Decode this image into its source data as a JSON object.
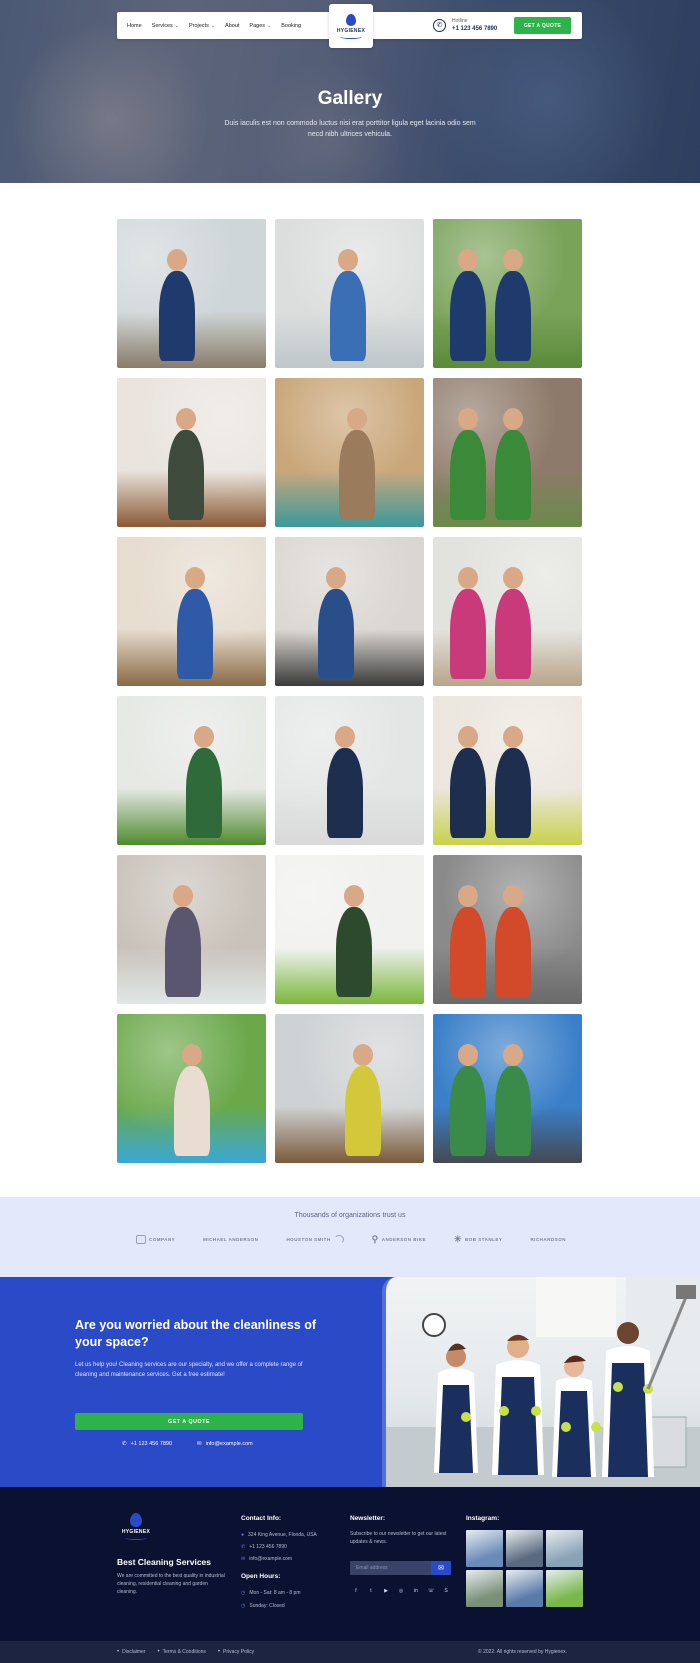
{
  "nav": {
    "links": [
      {
        "label": "Home",
        "dropdown": false
      },
      {
        "label": "Services",
        "dropdown": true
      },
      {
        "label": "Projects",
        "dropdown": true
      },
      {
        "label": "About",
        "dropdown": false
      },
      {
        "label": "Pages",
        "dropdown": true
      },
      {
        "label": "Booking",
        "dropdown": false
      }
    ],
    "logo_text": "HYGIENEX",
    "phone_label": "Hotline",
    "phone_number": "+1 123 456 7890",
    "quote_label": "GET A QUOTE"
  },
  "hero": {
    "title": "Gallery",
    "subtitle": "Duis iaculis est non commodo luctus nisi erat porttitor ligula eget lacinia odio sem necd nibh ultrices vehicula."
  },
  "gallery": {
    "tiles": [
      {
        "bg": "#cfd6d8",
        "accent": "#1f3b6e",
        "floor": "#8a7c6a",
        "icon": "office-cleaning"
      },
      {
        "bg": "#dcdedd",
        "accent": "#3a6fb5",
        "floor": "#bfc7cb",
        "icon": "window-cleaning"
      },
      {
        "bg": "#7aa35a",
        "accent": "#1f3b6e",
        "floor": "#5b8a3a",
        "icon": "garden-cleaning"
      },
      {
        "bg": "#e9e4de",
        "accent": "#3e4a3c",
        "floor": "#8a5a35",
        "icon": "home-mopping"
      },
      {
        "bg": "#caa77a",
        "accent": "#9a7b5c",
        "floor": "#3a9a9a",
        "icon": "door-wiping"
      },
      {
        "bg": "#8e7a6a",
        "accent": "#3a8a3a",
        "floor": "#6a8a4a",
        "icon": "terrace-gardening"
      },
      {
        "bg": "#e6dccf",
        "accent": "#2e5aa8",
        "floor": "#8a6a45",
        "icon": "desk-cleaning"
      },
      {
        "bg": "#dad6d1",
        "accent": "#2a4e8a",
        "floor": "#3a3a3a",
        "icon": "spray-cleaning"
      },
      {
        "bg": "#e2e2de",
        "accent": "#c93a7a",
        "floor": "#b9a58a",
        "icon": "family-cleaning"
      },
      {
        "bg": "#e6e8e4",
        "accent": "#2e6a3a",
        "floor": "#4f8a2e",
        "icon": "greenhouse"
      },
      {
        "bg": "#e4e6e6",
        "accent": "#1e2e4e",
        "floor": "#d9d9d9",
        "icon": "team-office"
      },
      {
        "bg": "#ebe6de",
        "accent": "#1e2e4e",
        "floor": "#c8d24a",
        "icon": "cleaning-duo"
      },
      {
        "bg": "#c9c2ba",
        "accent": "#5a5670",
        "floor": "#e0e6e6",
        "icon": "window-squeegee"
      },
      {
        "bg": "#f0f0ee",
        "accent": "#2e4a2e",
        "floor": "#7ab83a",
        "icon": "clean-room"
      },
      {
        "bg": "#8a8a8a",
        "accent": "#d24a2a",
        "floor": "#6a6a6a",
        "icon": "vacuum-machine"
      },
      {
        "bg": "#6aa84a",
        "accent": "#e8ddd0",
        "floor": "#3aa8d8",
        "icon": "pool-cleaning"
      },
      {
        "bg": "#cfd2d4",
        "accent": "#d2c83a",
        "floor": "#7a5a3a",
        "icon": "kitchen-wiping"
      },
      {
        "bg": "#3a7fc8",
        "accent": "#3a8a4a",
        "floor": "#444a50",
        "icon": "gutter-cleaning"
      }
    ]
  },
  "trust": {
    "title": "Thousands of organizations trust us",
    "brands": [
      "COMPANY",
      "MICHAEL ANDERSON",
      "HOUSTON SMITH",
      "ANDERSON BIKE",
      "BOB STANLEY",
      "RICHARDSON"
    ]
  },
  "cta": {
    "title": "Are you worried about the cleanliness of your space?",
    "text": "Let us help you! Cleaning services are our specialty, and we offer a complete range of cleaning and maintenance services. Get a free estimate!",
    "button": "GET A QUOTE",
    "phone": "+1 123 456 7890",
    "email": "info@example.com"
  },
  "footer": {
    "logo_text": "HYGIENEX",
    "brand_title": "Best Cleaning Services",
    "brand_text": "We are committed to the best quality in industrial cleaning, residential cleaning and garden cleaning.",
    "contact_heading": "Contact Info:",
    "address": "324 King Avenue, Florida, USA",
    "phone": "+1 123 456 7890",
    "email": "info@example.com",
    "hours_heading": "Open Hours:",
    "hours_weekday": "Mon - Sat: 8 am - 8 pm",
    "hours_sunday": "Sunday: Closed",
    "newsletter_heading": "Newsletter:",
    "newsletter_text": "Subscribe to our newsletter to get our latest updates & news.",
    "newsletter_placeholder": "Email address",
    "instagram_heading": "Instagram:",
    "instagram_tiles": [
      "#6a8ab8",
      "#5a6a80",
      "#8aa2b8",
      "#7a9078",
      "#5a7aa8",
      "#7ab84a"
    ],
    "bottom_links": [
      "Disclaimer",
      "Terms & Conditions",
      "Privacy Policy"
    ],
    "copyright": "© 2022. All rights reserved by Hygienex."
  },
  "colors": {
    "primary_blue": "#2b4ac7",
    "accent_green": "#2eb24a",
    "footer_navy": "#0b1130",
    "trust_bg": "#e3e9fa"
  }
}
